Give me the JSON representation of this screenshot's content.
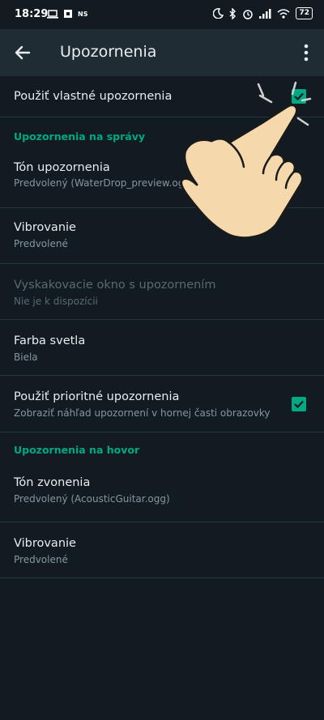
{
  "status_bar": {
    "time": "18:29",
    "carrier_tag": "NS",
    "battery": "72"
  },
  "app_bar": {
    "title": "Upozornenia"
  },
  "settings": {
    "custom_notifications": {
      "title": "Použiť vlastné upozornenia",
      "checked": true
    },
    "message_section": {
      "header": "Upozornenia na správy"
    },
    "message_tone": {
      "title": "Tón upozornenia",
      "value": "Predvolený (WaterDrop_preview.ogg)"
    },
    "message_vibrate": {
      "title": "Vibrovanie",
      "value": "Predvolené"
    },
    "popup": {
      "title": "Vyskakovacie okno s upozornením",
      "value": "Nie je k dispozícii"
    },
    "light": {
      "title": "Farba svetla",
      "value": "Biela"
    },
    "priority": {
      "title": "Použiť prioritné upozornenia",
      "value": "Zobraziť náhľad upozornení v hornej časti obrazovky",
      "checked": true
    },
    "call_section": {
      "header": "Upozornenia na hovor"
    },
    "ringtone": {
      "title": "Tón zvonenia",
      "value": "Predvolený (AcousticGuitar.ogg)"
    },
    "call_vibrate": {
      "title": "Vibrovanie",
      "value": "Predvolené"
    }
  },
  "colors": {
    "accent": "#00a884",
    "background": "#121b22",
    "appbar": "#1f2c34"
  },
  "icons": {
    "back": "arrow-left-icon",
    "more": "more-vert-icon",
    "hand": "pointing-hand-icon"
  }
}
